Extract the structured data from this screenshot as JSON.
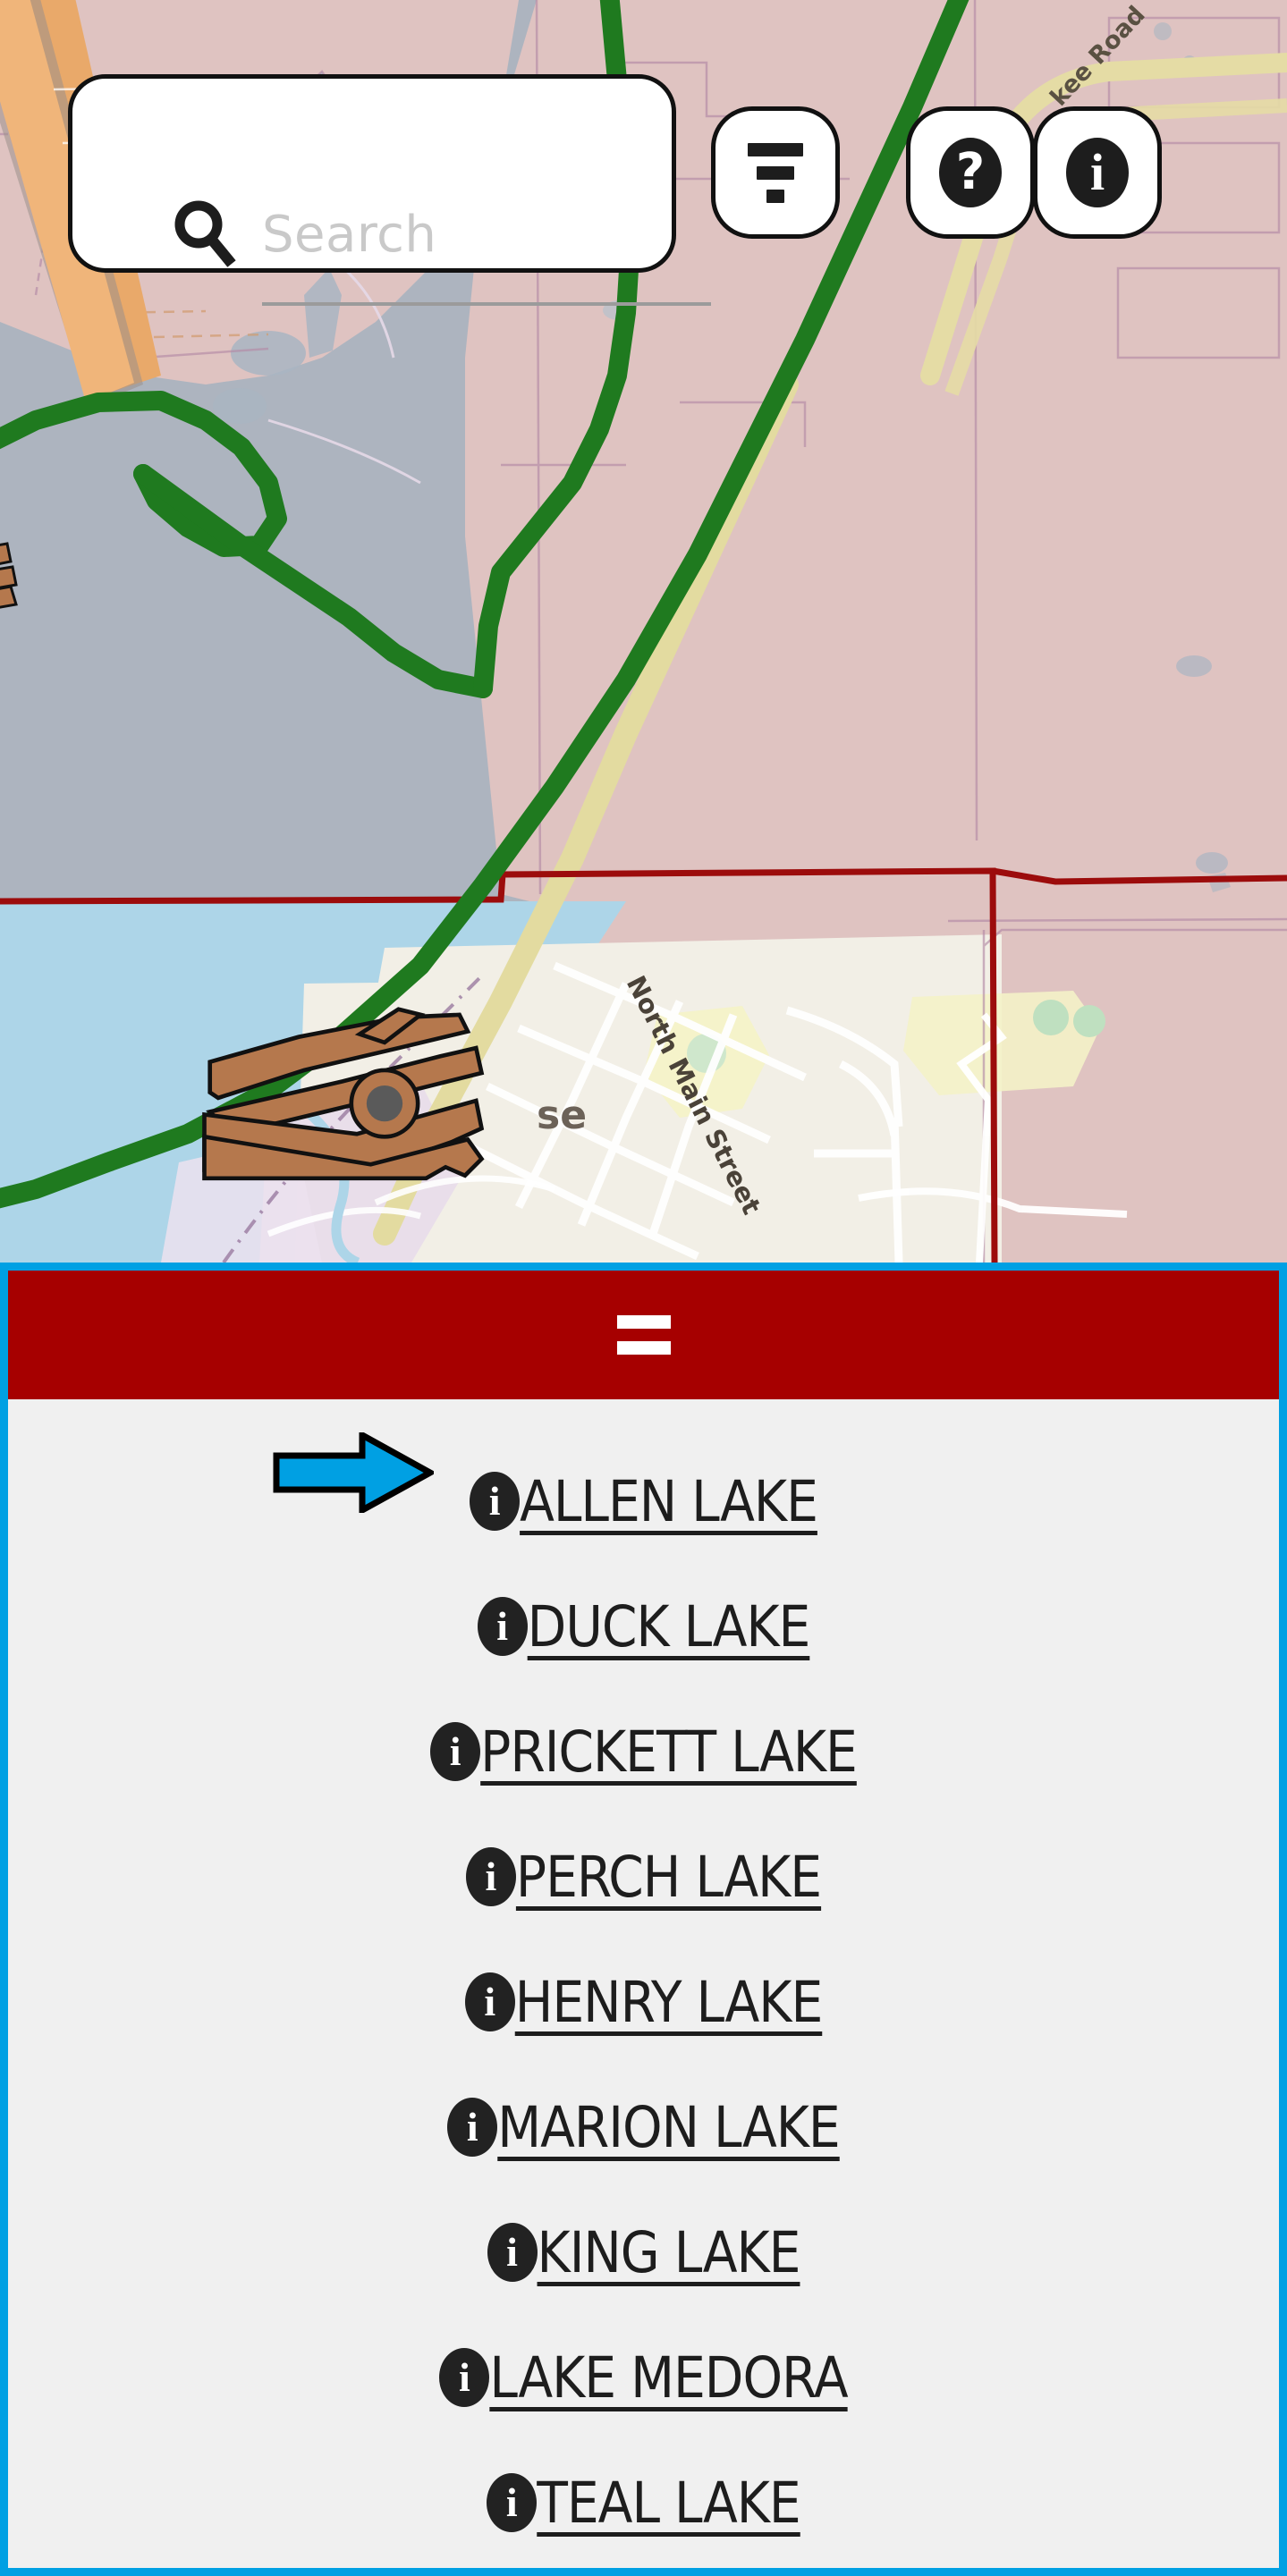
{
  "search": {
    "placeholder": "Search",
    "value": "",
    "icon": "search-icon"
  },
  "toolbar": {
    "filter_button": {
      "icon": "filter-icon",
      "label": ""
    },
    "help_button": {
      "icon": "help-icon",
      "label": "?"
    },
    "info_button": {
      "icon": "info-icon",
      "label": "i"
    }
  },
  "map": {
    "labels": [
      {
        "text": "North Main Street",
        "kind": "street"
      },
      {
        "text": "kee Road",
        "kind": "street"
      },
      {
        "text": "se",
        "kind": "place"
      }
    ],
    "colors": {
      "water_deep": "#adb4bf",
      "water_light": "#add5e8",
      "land_pink": "#dfc3c1",
      "land_cream": "#f2efe6",
      "boundary_green": "#1f7a1f",
      "boundary_red": "#9c0c0c",
      "road_yellow": "#eceaa0",
      "road_orange": "#e9a96a",
      "road_tan": "#e3dba0",
      "marker_brown": "#b5784d"
    },
    "markers": [
      {
        "name": "boat-launch-marker",
        "kind": "clothespin"
      },
      {
        "name": "boat-launch-marker-edge",
        "kind": "clothespin"
      }
    ]
  },
  "panel": {
    "header": {
      "icon": "drag-handle-icon",
      "label": ""
    },
    "accent_color": "#00a0e3",
    "header_color": "#a60000",
    "background_color": "#f0f0f0",
    "pointer": {
      "icon": "arrow-right-icon",
      "points_to": "ALLEN LAKE"
    },
    "lakes": [
      {
        "name": "ALLEN LAKE",
        "icon": "info-icon"
      },
      {
        "name": "DUCK LAKE",
        "icon": "info-icon"
      },
      {
        "name": "PRICKETT LAKE",
        "icon": "info-icon"
      },
      {
        "name": "PERCH LAKE",
        "icon": "info-icon"
      },
      {
        "name": "HENRY LAKE",
        "icon": "info-icon"
      },
      {
        "name": "MARION LAKE",
        "icon": "info-icon"
      },
      {
        "name": "KING LAKE",
        "icon": "info-icon"
      },
      {
        "name": "LAKE MEDORA",
        "icon": "info-icon"
      },
      {
        "name": "TEAL LAKE",
        "icon": "info-icon"
      }
    ]
  }
}
